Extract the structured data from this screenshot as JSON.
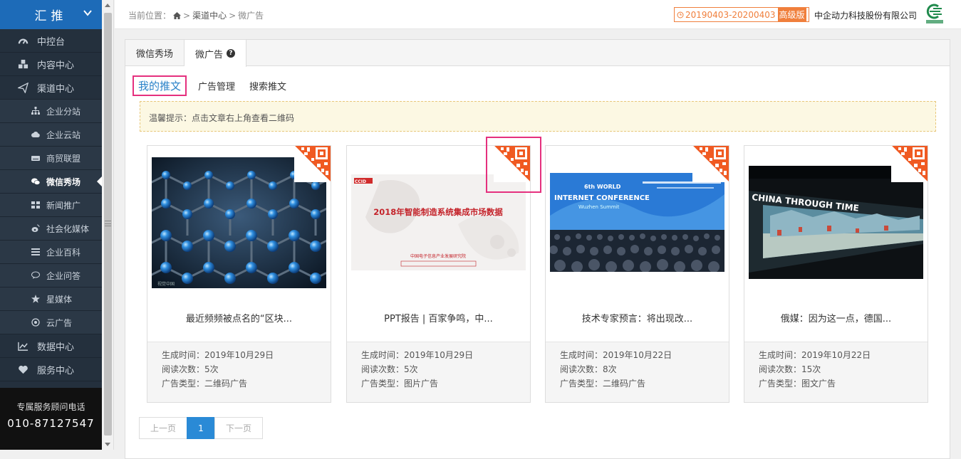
{
  "sidebar": {
    "brand": "汇推",
    "items": [
      {
        "label": "中控台",
        "level": "top",
        "icon": "dashboard-icon"
      },
      {
        "label": "内容中心",
        "level": "top",
        "icon": "cubes-icon"
      },
      {
        "label": "渠道中心",
        "level": "top",
        "icon": "paper-plane-icon"
      },
      {
        "label": "企业分站",
        "level": "sub",
        "icon": "sitemap-icon"
      },
      {
        "label": "企业云站",
        "level": "sub",
        "icon": "cloud-icon"
      },
      {
        "label": "商贸联盟",
        "level": "sub",
        "icon": "drive-icon"
      },
      {
        "label": "微信秀场",
        "level": "sub",
        "icon": "wechat-icon",
        "active": true
      },
      {
        "label": "新闻推广",
        "level": "sub",
        "icon": "grid-icon"
      },
      {
        "label": "社会化媒体",
        "level": "sub",
        "icon": "weibo-icon"
      },
      {
        "label": "企业百科",
        "level": "sub",
        "icon": "list-icon"
      },
      {
        "label": "企业问答",
        "level": "sub",
        "icon": "comments-icon"
      },
      {
        "label": "星媒体",
        "level": "sub",
        "icon": "star-icon"
      },
      {
        "label": "云广告",
        "level": "sub",
        "icon": "bullseye-icon"
      },
      {
        "label": "数据中心",
        "level": "top",
        "icon": "line-chart-icon"
      },
      {
        "label": "服务中心",
        "level": "top",
        "icon": "heart-icon"
      }
    ],
    "hotline_label": "专属服务顾问电话",
    "hotline_number": "010-87127547"
  },
  "topbar": {
    "crumb_prefix": "当前位置：",
    "crumb_sep1": ">",
    "crumb_channel": "渠道中心",
    "crumb_sep2": ">",
    "crumb_current": "微广告",
    "period": "20190403-20200403",
    "edition": "高级版",
    "company": "中企动力科技股份有限公司"
  },
  "tabs": [
    {
      "label": "微信秀场",
      "active": false
    },
    {
      "label": "微广告",
      "active": true
    }
  ],
  "subtabs": [
    {
      "label": "我的推文",
      "active": true
    },
    {
      "label": "广告管理",
      "active": false
    },
    {
      "label": "搜索推文",
      "active": false
    }
  ],
  "notice": "温馨提示：点击文章右上角查看二维码",
  "meta_labels": {
    "created": "生成时间：",
    "reads": "阅读次数：",
    "ad_type": "广告类型："
  },
  "cards": [
    {
      "title": "最近频频被点名的“区块...",
      "created": "2019年10月29日",
      "reads": "5次",
      "ad_type": "二维码广告",
      "image": "graphene-image",
      "watermark": "视觉中国"
    },
    {
      "title": "PPT报告 | 百家争鸣，中...",
      "created": "2019年10月29日",
      "reads": "5次",
      "ad_type": "图片广告",
      "image": "report-cover-image",
      "img_brand": "CCID",
      "img_title": "2018年智能制造系统集成市场数据",
      "img_org": "中国电子信息产业发展研究院"
    },
    {
      "title": "技术专家预言：将出现改...",
      "created": "2019年10月22日",
      "reads": "8次",
      "ad_type": "二维码广告",
      "image": "conference-image",
      "img_line1": "6th WORLD",
      "img_line2": "INTERNET CONFERENCE",
      "img_line3": "Wuzhen Summit"
    },
    {
      "title": "俄媒：因为这一点，德国...",
      "created": "2019年10月22日",
      "reads": "15次",
      "ad_type": "图文广告",
      "image": "china-through-time-image",
      "img_text": "CHINA THROUGH TIME"
    }
  ],
  "pager": {
    "prev": "上一页",
    "current": "1",
    "next": "下一页"
  },
  "colors": {
    "sidebar": "#24303d",
    "brand": "#1d6bb8",
    "accent": "#2a8ad6",
    "highlight": "#e5307e",
    "qr": "#f05a22"
  }
}
